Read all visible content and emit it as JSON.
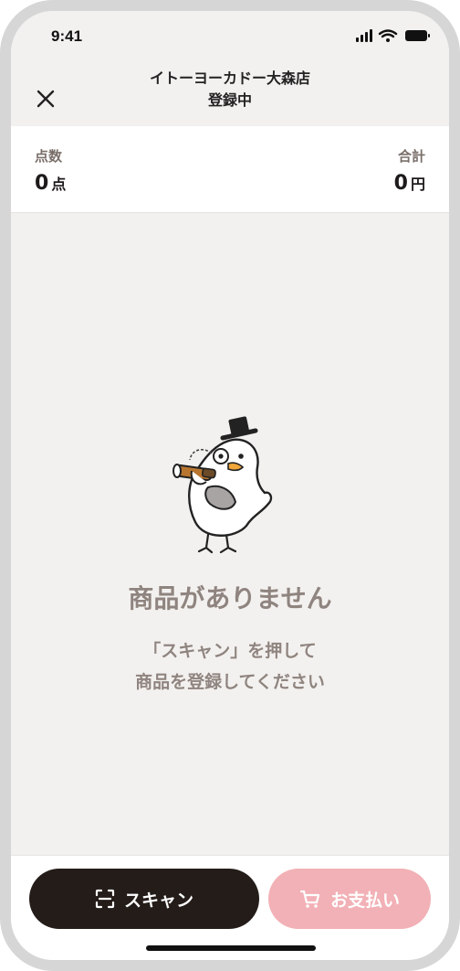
{
  "status_bar": {
    "time": "9:41",
    "icons": [
      "signal-icon",
      "wifi-icon",
      "battery-icon"
    ]
  },
  "header": {
    "store_name": "イトーヨーカドー大森店",
    "state": "登録中",
    "close_icon": "close-icon"
  },
  "summary": {
    "count_label": "点数",
    "count_value": "0",
    "count_unit": "点",
    "total_label": "合計",
    "total_value": "0",
    "total_unit": "円"
  },
  "empty_state": {
    "title": "商品がありません",
    "line1": "「スキャン」を押して",
    "line2": "商品を登録してください"
  },
  "actions": {
    "scan_label": "スキャン",
    "pay_label": "お支払い",
    "scan_icon": "scan-icon",
    "pay_icon": "cart-icon"
  },
  "colors": {
    "background": "#f3f1ef",
    "primary_button": "#241c19",
    "pay_button_disabled": "#f2b1b6",
    "muted_text": "#8f847f"
  }
}
